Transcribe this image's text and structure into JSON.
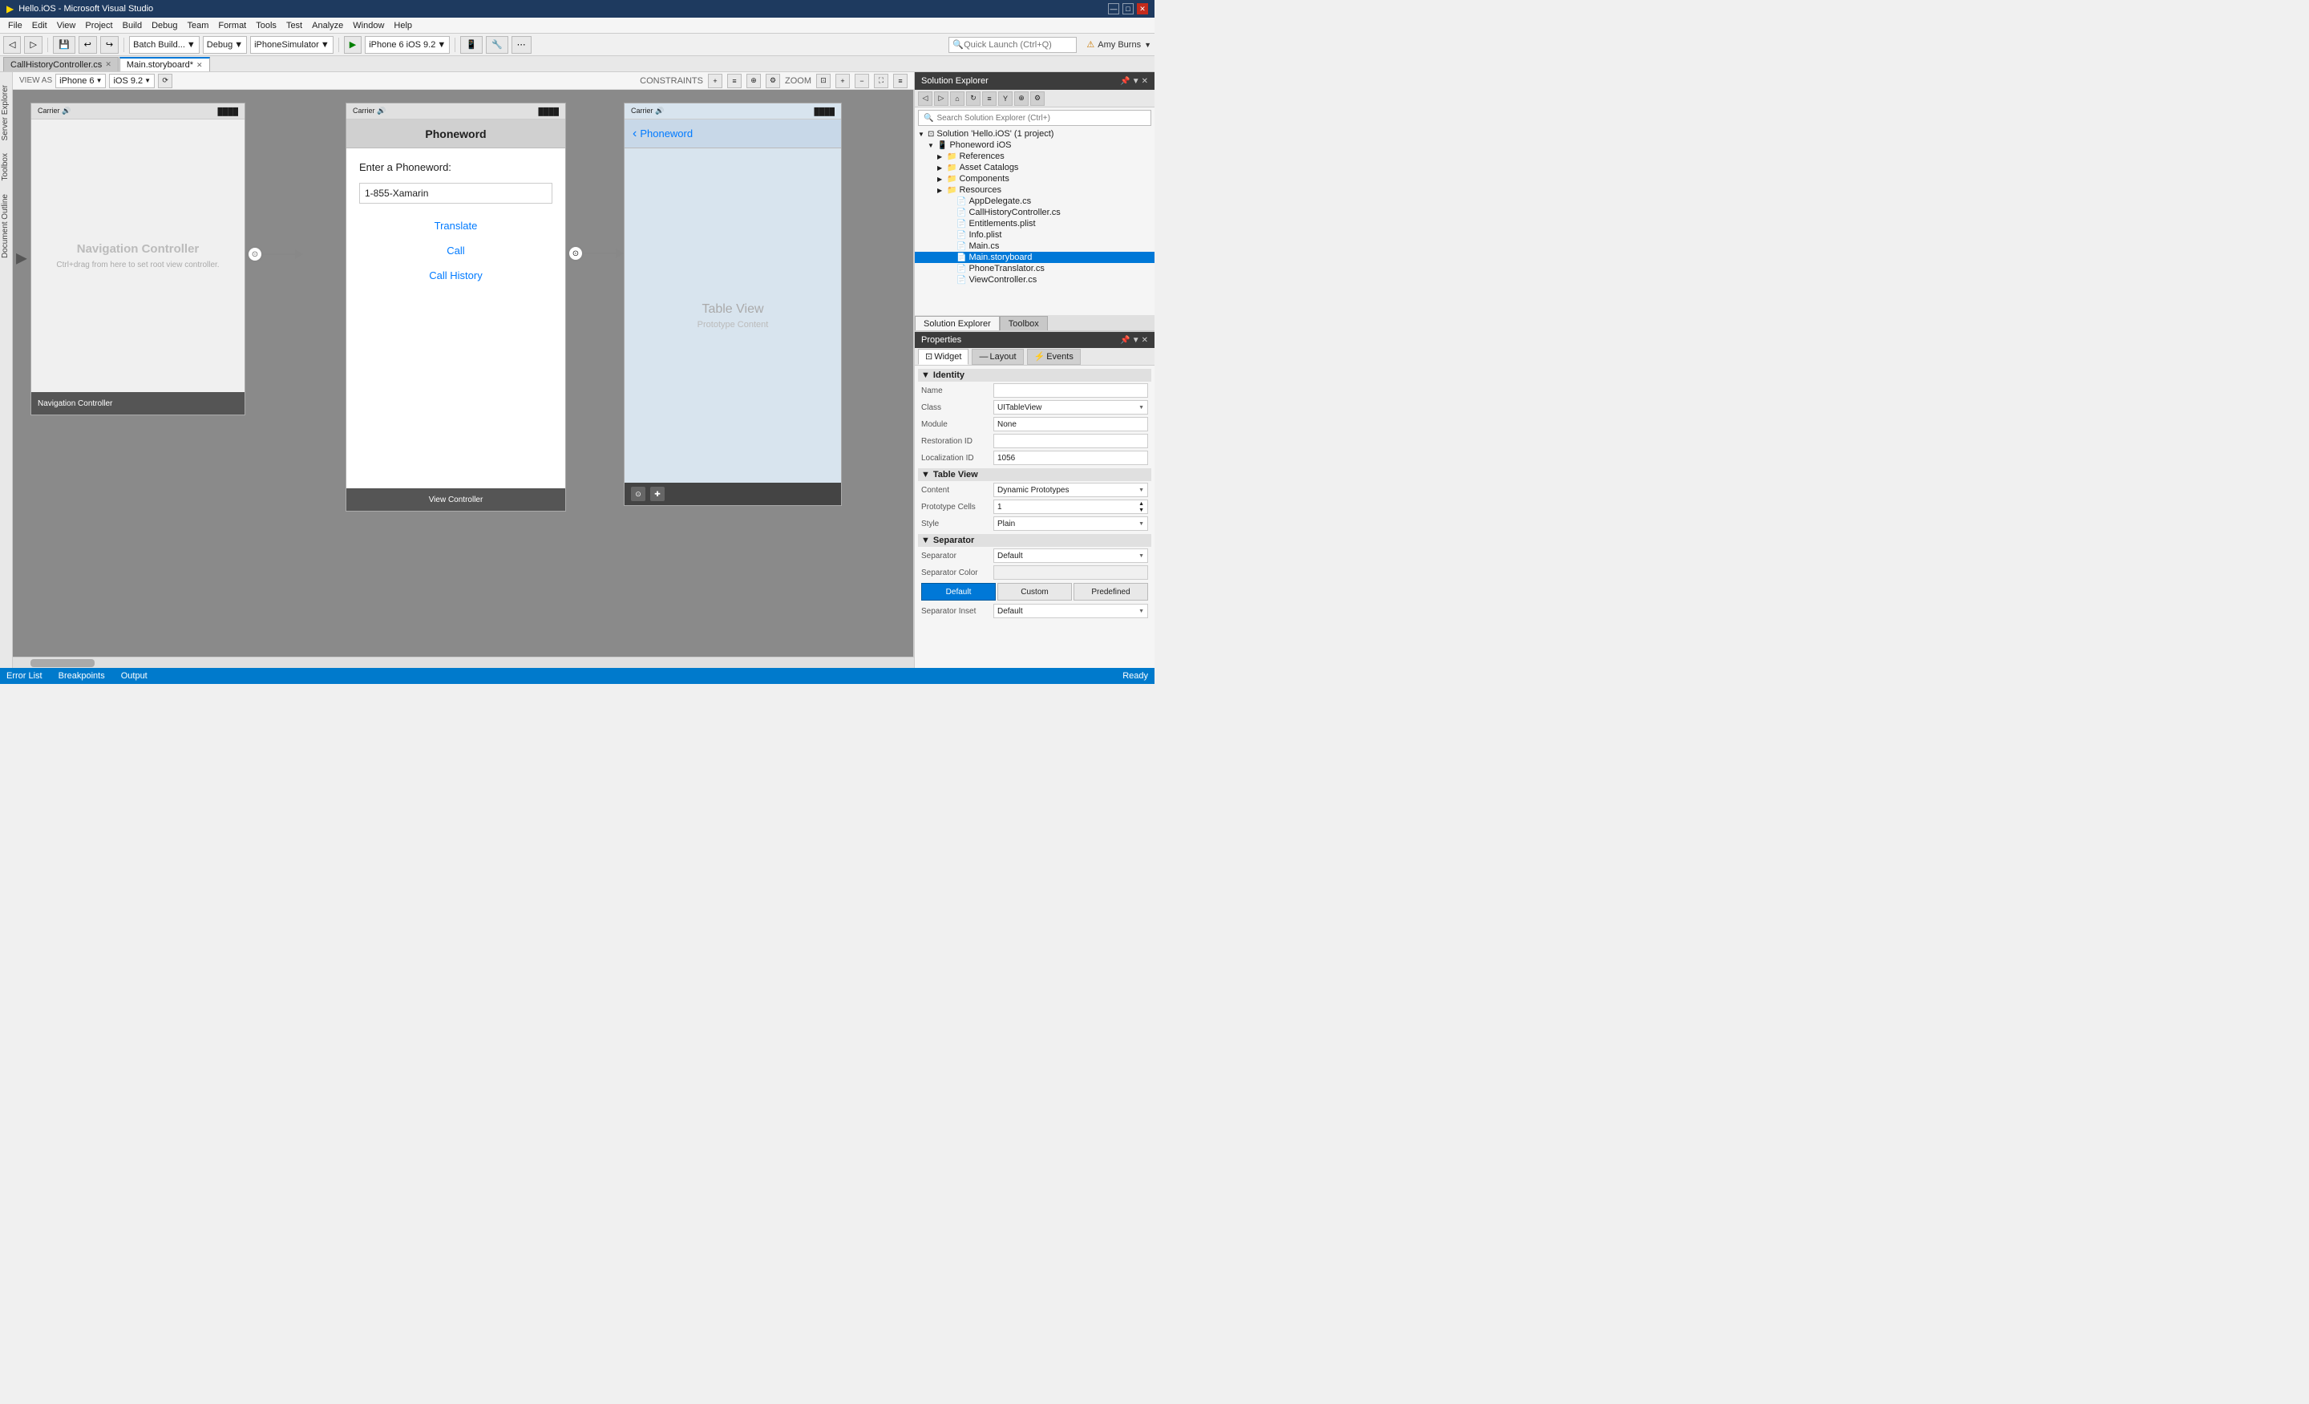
{
  "titlebar": {
    "title": "Hello.iOS - Microsoft Visual Studio",
    "logo": "▶",
    "min": "—",
    "max": "□",
    "close": "✕"
  },
  "menubar": {
    "items": [
      "File",
      "Edit",
      "View",
      "Project",
      "Build",
      "Debug",
      "Team",
      "Format",
      "Tools",
      "Test",
      "Analyze",
      "Window",
      "Help"
    ]
  },
  "toolbar": {
    "back": "◁",
    "forward": "▷",
    "save_all": "💾",
    "start": "▶",
    "start_label": "iPhone 6 iOS 9.2",
    "batch_build": "Batch Build...",
    "debug": "Debug",
    "configuration": "iPhoneSimulator",
    "search_placeholder": "Quick Launch (Ctrl+Q)",
    "user": "Amy Burns",
    "warning_icon": "⚠"
  },
  "tabs": {
    "items": [
      {
        "label": "CallHistoryController.cs",
        "active": false,
        "closable": true
      },
      {
        "label": "Main.storyboard*",
        "active": true,
        "closable": true
      }
    ]
  },
  "constraints_bar": {
    "view_as_label": "VIEW AS",
    "device": "iPhone 6",
    "ios": "iOS 9.2",
    "constraints_label": "CONSTRAINTS",
    "zoom_label": "ZOOM"
  },
  "canvas": {
    "background": "#8a8a8a",
    "nav_controller": {
      "status_carrier": "Carrier",
      "status_wifi": "WiFi",
      "status_battery": "████",
      "title": "Navigation Controller",
      "subtitle": "Ctrl+drag from here to set root view controller.",
      "footer_label": "Navigation Controller"
    },
    "view_controller": {
      "status_carrier": "Carrier",
      "title": "Phoneword",
      "label": "Enter a Phoneword:",
      "input_value": "1-855-Xamarin",
      "btn_translate": "Translate",
      "btn_call": "Call",
      "btn_history": "Call History",
      "footer_label": "View Controller"
    },
    "table_controller": {
      "status_carrier": "Carrier",
      "back_label": "Phoneword",
      "title": "Table View",
      "subtitle": "Prototype Content"
    }
  },
  "solution_explorer": {
    "header": "Solution Explorer",
    "search_placeholder": "Search Solution Explorer (Ctrl+)",
    "solution_label": "Solution 'Hello.iOS' (1 project)",
    "project_label": "Phoneword iOS",
    "tree": [
      {
        "label": "References",
        "indent": 2,
        "icon": "📁",
        "expanded": false
      },
      {
        "label": "Asset Catalogs",
        "indent": 2,
        "icon": "📁",
        "expanded": false
      },
      {
        "label": "Components",
        "indent": 2,
        "icon": "📁",
        "expanded": false
      },
      {
        "label": "Resources",
        "indent": 2,
        "icon": "📁",
        "expanded": false
      },
      {
        "label": "AppDelegate.cs",
        "indent": 2,
        "icon": "📄"
      },
      {
        "label": "CallHistoryController.cs",
        "indent": 2,
        "icon": "📄"
      },
      {
        "label": "Entitlements.plist",
        "indent": 2,
        "icon": "📄"
      },
      {
        "label": "Info.plist",
        "indent": 2,
        "icon": "📄"
      },
      {
        "label": "Main.cs",
        "indent": 2,
        "icon": "📄"
      },
      {
        "label": "Main.storyboard",
        "indent": 2,
        "icon": "📄",
        "selected": true
      },
      {
        "label": "PhoneTranslator.cs",
        "indent": 2,
        "icon": "📄"
      },
      {
        "label": "ViewController.cs",
        "indent": 2,
        "icon": "📄"
      }
    ],
    "tabs": [
      "Solution Explorer",
      "Toolbox"
    ]
  },
  "properties": {
    "header": "Properties",
    "tabs": [
      "Widget",
      "Layout",
      "Events"
    ],
    "active_tab": "Widget",
    "identity_section": "Identity",
    "name_label": "Name",
    "name_value": "",
    "class_label": "Class",
    "class_value": "UITableView",
    "module_label": "Module",
    "module_value": "None",
    "restoration_id_label": "Restoration ID",
    "restoration_id_value": "",
    "localization_id_label": "Localization ID",
    "localization_id_value": "1056",
    "table_view_section": "Table View",
    "content_label": "Content",
    "content_value": "Dynamic Prototypes",
    "prototype_cells_label": "Prototype Cells",
    "prototype_cells_value": "1",
    "style_label": "Style",
    "style_value": "Plain",
    "separator_section": "Separator",
    "separator_label": "Separator",
    "separator_value": "Default",
    "separator_color_label": "Separator Color",
    "btn_default": "Default",
    "btn_custom": "Custom",
    "btn_predefined": "Predefined",
    "separator_inset_label": "Separator Inset",
    "separator_inset_value": "Default"
  },
  "statusbar": {
    "items": [
      "Error List",
      "Breakpoints",
      "Output"
    ],
    "ready": "Ready"
  }
}
